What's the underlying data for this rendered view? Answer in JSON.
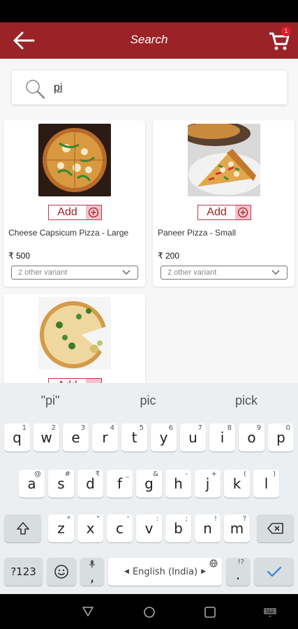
{
  "app_bar": {
    "title": "Search",
    "cart_count": "1"
  },
  "search": {
    "query": "pi"
  },
  "products": [
    {
      "name": "Cheese Capsicum Pizza - Large",
      "price": "₹ 500",
      "add_label": "Add",
      "variant": "2 other variant"
    },
    {
      "name": "Paneer Pizza - Small",
      "price": "₹ 200",
      "add_label": "Add",
      "variant": "2 other variant"
    }
  ],
  "keyboard": {
    "suggestions": [
      "\"pi\"",
      "pic",
      "pick"
    ],
    "row1": [
      {
        "k": "q",
        "h": "1"
      },
      {
        "k": "w",
        "h": "2"
      },
      {
        "k": "e",
        "h": "3"
      },
      {
        "k": "r",
        "h": "4"
      },
      {
        "k": "t",
        "h": "5"
      },
      {
        "k": "y",
        "h": "6"
      },
      {
        "k": "u",
        "h": "7"
      },
      {
        "k": "i",
        "h": "8"
      },
      {
        "k": "o",
        "h": "9"
      },
      {
        "k": "p",
        "h": "0"
      }
    ],
    "row2": [
      {
        "k": "a",
        "h": "@"
      },
      {
        "k": "s",
        "h": "#"
      },
      {
        "k": "d",
        "h": "₹"
      },
      {
        "k": "f",
        "h": "_"
      },
      {
        "k": "g",
        "h": "&"
      },
      {
        "k": "h",
        "h": "-"
      },
      {
        "k": "j",
        "h": "+"
      },
      {
        "k": "k",
        "h": "("
      },
      {
        "k": "l",
        "h": ")"
      }
    ],
    "row3": [
      {
        "k": "z",
        "h": "*"
      },
      {
        "k": "x",
        "h": "\""
      },
      {
        "k": "c",
        "h": "'"
      },
      {
        "k": "v",
        "h": ":"
      },
      {
        "k": "b",
        "h": ";"
      },
      {
        "k": "n",
        "h": "!"
      },
      {
        "k": "m",
        "h": "?"
      }
    ],
    "symbols_label": "?123",
    "comma_label": ",",
    "space_label": "English (India)",
    "period_label": ".",
    "period_hint": "!?"
  }
}
